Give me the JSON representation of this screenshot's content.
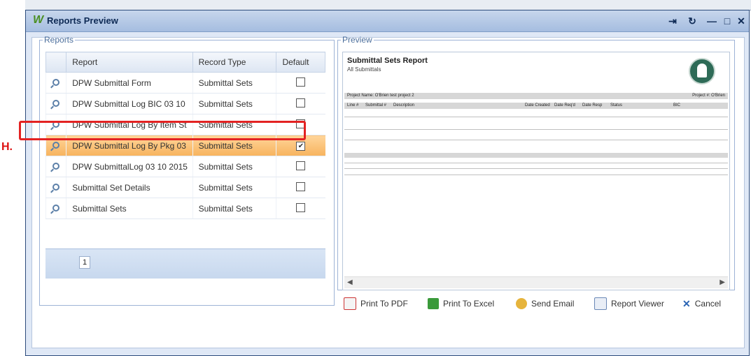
{
  "window": {
    "title": "Reports Preview"
  },
  "reports": {
    "legend": "Reports",
    "columns": [
      "Report",
      "Record Type",
      "Default"
    ],
    "rows": [
      {
        "report": "DPW Submittal Form",
        "record_type": "Submittal Sets",
        "default": false
      },
      {
        "report": "DPW Submittal Log BIC 03 10",
        "record_type": "Submittal Sets",
        "default": false
      },
      {
        "report": "DPW Submittal Log By Item St",
        "record_type": "Submittal Sets",
        "default": false
      },
      {
        "report": "DPW Submittal Log By Pkg 03",
        "record_type": "Submittal Sets",
        "default": true,
        "selected": true
      },
      {
        "report": "DPW SubmittalLog 03 10 2015",
        "record_type": "Submittal Sets",
        "default": false
      },
      {
        "report": "Submittal Set Details",
        "record_type": "Submittal Sets",
        "default": false
      },
      {
        "report": "Submittal Sets",
        "record_type": "Submittal Sets",
        "default": false
      }
    ],
    "page": "1"
  },
  "annotation": {
    "marker": "H."
  },
  "preview": {
    "legend": "Preview",
    "report_title": "Submittal Sets Report",
    "report_subtitle": "All Submittals",
    "project_label": "Project Name:",
    "project_value": "O'Brien test project 2",
    "project_num_label": "Project #:",
    "project_num_value": "O'Brien",
    "col_line": "Line #",
    "col_submittal": "Submittal #",
    "col_desc": "Description",
    "col_created": "Date Created",
    "col_reqd": "Date Req'd",
    "col_resp": "Date Resp",
    "col_status": "Status",
    "col_bic": "BIC"
  },
  "actions": {
    "print_pdf": "Print To PDF",
    "print_excel": "Print To Excel",
    "send_email": "Send Email",
    "report_viewer": "Report Viewer",
    "cancel": "Cancel"
  },
  "colors": {
    "accent": "#f7b35e",
    "highlight": "#e32222",
    "titlebar": "#a5bde0"
  }
}
